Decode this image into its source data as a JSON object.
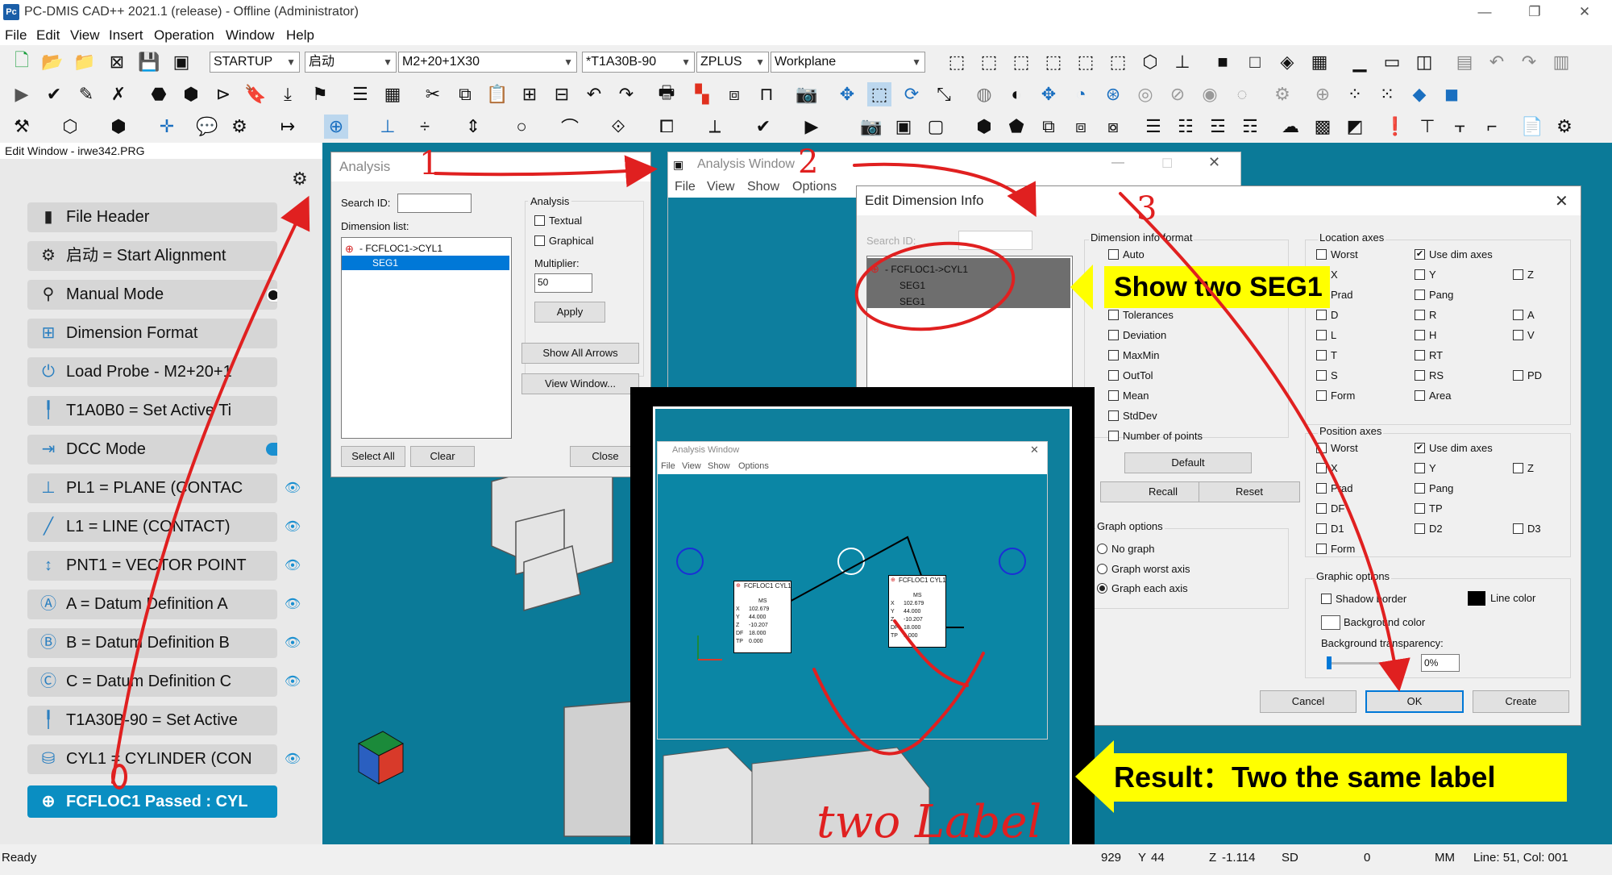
{
  "titlebar": {
    "app_icon": "Pc",
    "title": "PC-DMIS CAD++ 2021.1 (release) - Offline (Administrator)",
    "minimize": "—",
    "restore": "❐",
    "close": "✕"
  },
  "menu": [
    "File",
    "Edit",
    "View",
    "Insert",
    "Operation",
    "Window",
    "Help"
  ],
  "toolbar": {
    "combo_startup": "STARTUP",
    "combo_alignment": "启动",
    "combo_probe": "M2+20+1X30",
    "combo_tip": "*T1A30B-90",
    "combo_view": "ZPLUS",
    "combo_workplane": "Workplane"
  },
  "edit_window": {
    "header": "Edit Window - irwe342.PRG",
    "items": [
      {
        "label": "File Header",
        "icon": "document-icon"
      },
      {
        "label": "启动 = Start Alignment",
        "icon": "alignment-icon"
      },
      {
        "label": "Manual Mode",
        "icon": "manual-mode-icon"
      },
      {
        "label": "Dimension Format",
        "icon": "dimension-format-icon"
      },
      {
        "label": "Load Probe - M2+20+1",
        "icon": "probe-icon"
      },
      {
        "label": "T1A0B0 = Set Active Ti",
        "icon": "tip-icon"
      },
      {
        "label": "DCC Mode",
        "icon": "dcc-icon"
      },
      {
        "label": "PL1 = PLANE (CONTAC",
        "icon": "plane-icon"
      },
      {
        "label": "L1 = LINE (CONTACT)",
        "icon": "line-icon"
      },
      {
        "label": "PNT1 = VECTOR POINT",
        "icon": "point-icon"
      },
      {
        "label": "A = Datum Definition A",
        "icon": "datum-icon"
      },
      {
        "label": "B = Datum Definition B",
        "icon": "datum-icon"
      },
      {
        "label": "C = Datum Definition C",
        "icon": "datum-icon"
      },
      {
        "label": "T1A30B-90 = Set Active",
        "icon": "tip-icon"
      },
      {
        "label": "CYL1 = CYLINDER (CON",
        "icon": "cylinder-icon"
      },
      {
        "label": "FCFLOC1 Passed : CYL",
        "icon": "position-icon"
      }
    ]
  },
  "analysis_dialog": {
    "title": "Analysis",
    "search_label": "Search ID:",
    "dim_list_label": "Dimension list:",
    "tree_parent": "- FCFLOC1->CYL1",
    "tree_child": "SEG1",
    "analysis_group": "Analysis",
    "textual": "Textual",
    "graphical": "Graphical",
    "multiplier_label": "Multiplier:",
    "multiplier_value": "50",
    "apply": "Apply",
    "show_all_arrows": "Show All Arrows",
    "view_window": "View Window...",
    "select_all": "Select All",
    "clear": "Clear",
    "close": "Close"
  },
  "analysis_window": {
    "title": "Analysis Window",
    "menu": [
      "File",
      "View",
      "Show",
      "Options"
    ]
  },
  "edit_dim_dialog": {
    "title": "Edit Dimension Info",
    "search_label": "Search ID:",
    "tree_parent": "- FCFLOC1->CYL1",
    "tree_children": [
      "SEG1",
      "SEG1"
    ],
    "format_group": "Dimension info format",
    "format_items": [
      "Auto",
      "Tolerances",
      "Deviation",
      "MaxMin",
      "OutTol",
      "Mean",
      "StdDev",
      "Number of points"
    ],
    "default": "Default",
    "recall": "Recall",
    "reset": "Reset",
    "graph_group": "Graph options",
    "graph_items": [
      "No graph",
      "Graph worst axis",
      "Graph each axis"
    ],
    "location_group": "Location axes",
    "location_items": [
      [
        "Worst",
        "Use dim axes",
        ""
      ],
      [
        "X",
        "Y",
        "Z"
      ],
      [
        "Prad",
        "Pang",
        ""
      ],
      [
        "D",
        "R",
        "A"
      ],
      [
        "L",
        "H",
        "V"
      ],
      [
        "T",
        "RT",
        ""
      ],
      [
        "S",
        "RS",
        "PD"
      ],
      [
        "Form",
        "Area",
        ""
      ]
    ],
    "position_group": "Position axes",
    "position_items": [
      [
        "Worst",
        "Use dim axes",
        ""
      ],
      [
        "X",
        "Y",
        "Z"
      ],
      [
        "Prad",
        "Pang",
        ""
      ],
      [
        "DF",
        "TP",
        ""
      ],
      [
        "D1",
        "D2",
        "D3"
      ],
      [
        "Form",
        "",
        ""
      ]
    ],
    "graphic_group": "Graphic options",
    "shadow_border": "Shadow border",
    "line_color": "Line color",
    "background_color": "Background color",
    "bg_transparency": "Background transparency:",
    "transparency_value": "0%",
    "cancel": "Cancel",
    "ok": "OK",
    "create": "Create"
  },
  "inset": {
    "title": "Analysis Window",
    "menu": [
      "File",
      "View",
      "Show",
      "Options"
    ],
    "label_title": "FCFLOC1 CYL1",
    "label_col": "MS",
    "rows": [
      {
        "k": "X",
        "v": "102.679"
      },
      {
        "k": "Y",
        "v": "44.000"
      },
      {
        "k": "Z",
        "v": "-10.207"
      },
      {
        "k": "DF",
        "v": "18.000"
      },
      {
        "k": "TP",
        "v": "0.000"
      }
    ]
  },
  "annotations": {
    "callout_seg": "Show two SEG1",
    "callout_result": "Result：Two the same label",
    "hand_two_label": "two Label",
    "num1": "1",
    "num2": "2",
    "num3": "3"
  },
  "status": {
    "ready": "Ready",
    "x": "929",
    "y_label": "Y",
    "y": "44",
    "z_label": "Z",
    "z": "-1.114",
    "sd": "SD",
    "sd_value": "0",
    "units": "MM",
    "position": "Line: 51, Col: 001"
  }
}
